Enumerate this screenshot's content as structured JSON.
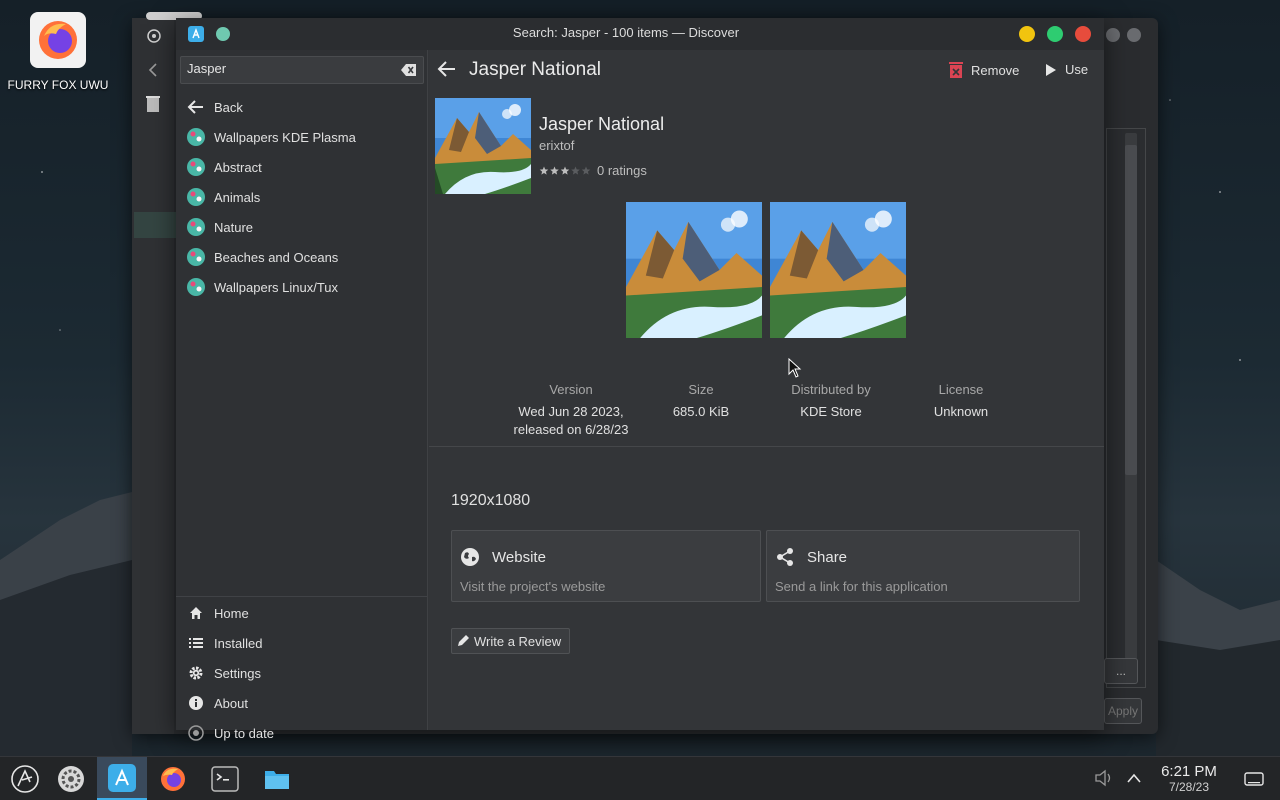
{
  "desktop": {
    "icon_label": "FURRY FOX UWU"
  },
  "window": {
    "title": "Search: Jasper - 100 items — Discover"
  },
  "sidebar": {
    "search_value": "Jasper",
    "back_label": "Back",
    "results": [
      {
        "label": "Wallpapers KDE Plasma"
      },
      {
        "label": "Abstract"
      },
      {
        "label": "Animals"
      },
      {
        "label": "Nature"
      },
      {
        "label": "Beaches and Oceans"
      },
      {
        "label": "Wallpapers Linux/Tux"
      }
    ],
    "bottom": [
      {
        "label": "Home",
        "icon": "home-icon"
      },
      {
        "label": "Installed",
        "icon": "list-icon"
      },
      {
        "label": "Settings",
        "icon": "gear-icon"
      },
      {
        "label": "About",
        "icon": "info-icon"
      },
      {
        "label": "Up to date",
        "icon": "update-status-icon"
      }
    ]
  },
  "page": {
    "title": "Jasper National",
    "remove_label": "Remove",
    "use_label": "Use"
  },
  "app": {
    "name": "Jasper National",
    "author": "erixtof",
    "rating_stars": 3,
    "rating_text": "0 ratings"
  },
  "meta": {
    "version_label": "Version",
    "version_value_1": "Wed Jun 28 2023,",
    "version_value_2": "released on 6/28/23",
    "size_label": "Size",
    "size_value": "685.0 KiB",
    "distributed_label": "Distributed by",
    "distributed_value": "KDE Store",
    "license_label": "License",
    "license_value": "Unknown"
  },
  "description": "1920x1080",
  "actions": {
    "website_title": "Website",
    "website_sub": "Visit the project's website",
    "share_title": "Share",
    "share_sub": "Send a link for this application",
    "review_label": "Write a Review"
  },
  "background_window": {
    "btn1_label": "...",
    "btn2_label": "Apply"
  },
  "taskbar": {
    "time": "6:21 PM",
    "date": "7/28/23"
  },
  "colors": {
    "accent": "#3daee9",
    "remove_red": "#da4453",
    "min": "#f1c40f",
    "max": "#2ecc71",
    "close": "#e74c3c"
  }
}
